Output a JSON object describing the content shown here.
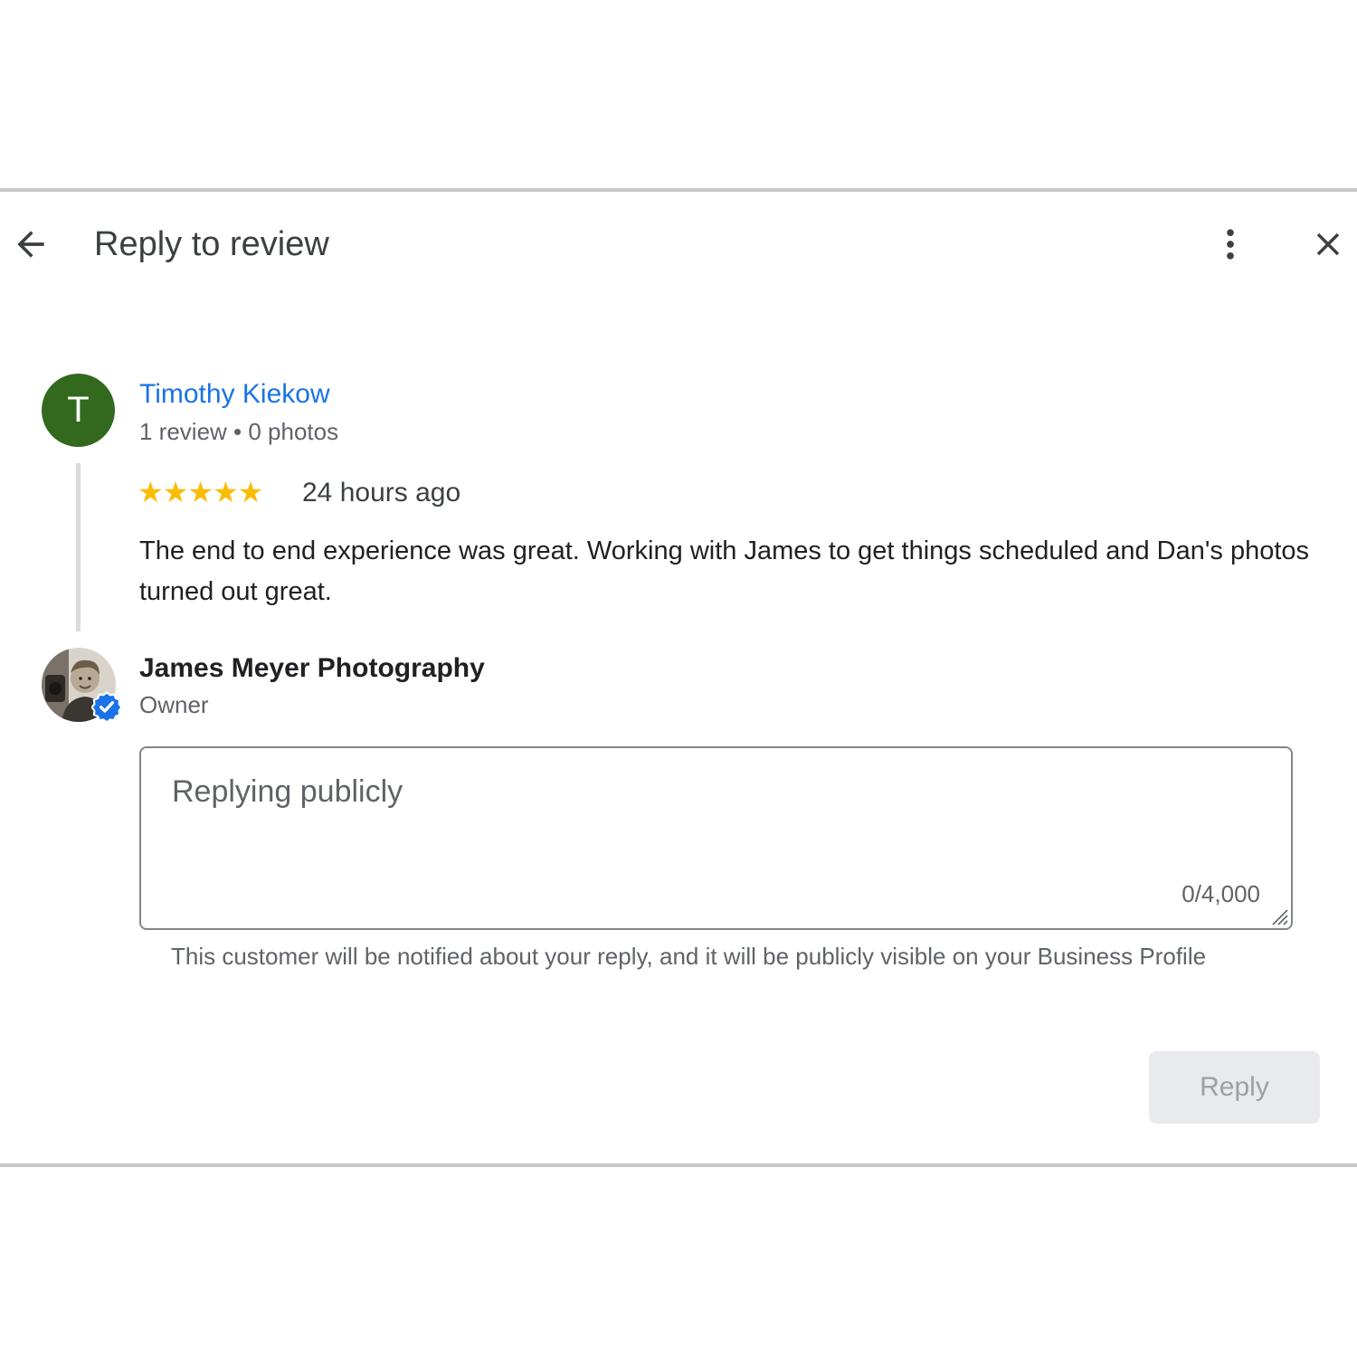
{
  "dialog": {
    "title": "Reply to review"
  },
  "review": {
    "avatar_initial": "T",
    "reviewer_name": "Timothy Kiekow",
    "reviewer_meta": "1 review • 0 photos",
    "rating": 5,
    "rating_stars": "★★★★★",
    "time_ago": "24 hours ago",
    "text": "The end to end experience was great. Working with James to get things scheduled and Dan's photos turned out great."
  },
  "owner": {
    "name": "James Meyer Photography",
    "role": "Owner"
  },
  "reply": {
    "placeholder": "Replying publicly",
    "value": "",
    "char_count": "0/4,000",
    "helper_text": "This customer will be notified about your reply, and it will be publicly visible on your Business Profile",
    "button_label": "Reply"
  },
  "colors": {
    "link": "#1a73e8",
    "avatar_bg": "#33691e",
    "star": "#fbbc04",
    "verified": "#1a73e8",
    "button_disabled_bg": "#e8eaed"
  },
  "icons": {
    "back": "arrow-back-icon",
    "more": "more-vert-icon",
    "close": "close-icon",
    "verified": "verified-badge-icon"
  }
}
